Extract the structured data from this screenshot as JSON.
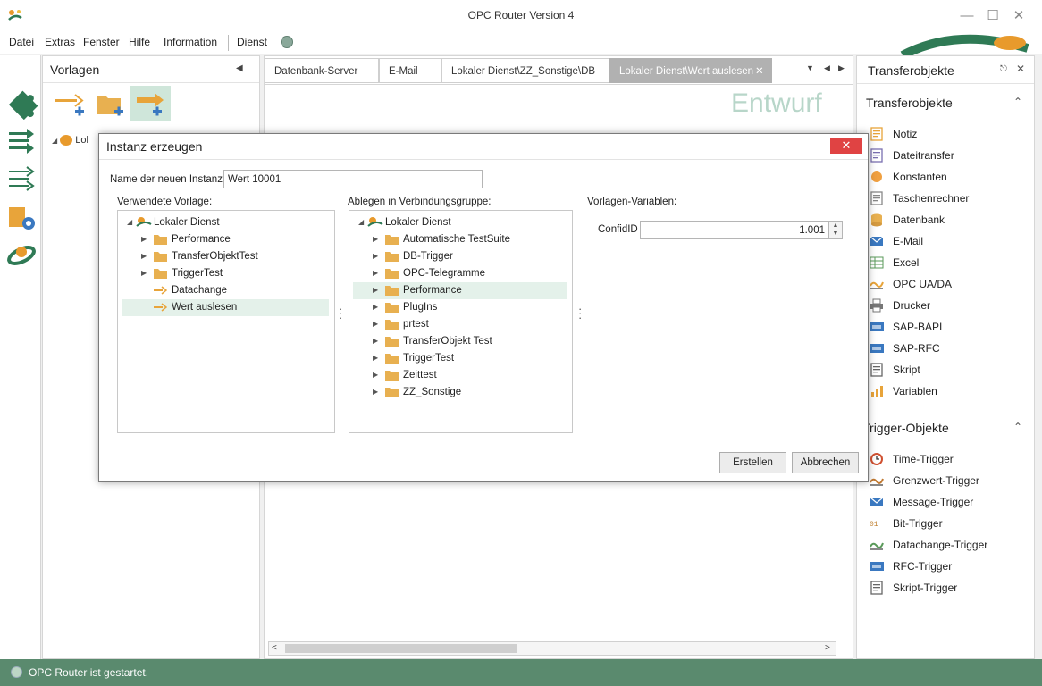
{
  "window": {
    "title": "OPC Router Version 4"
  },
  "menu": {
    "items": [
      "Datei",
      "Extras",
      "Fenster",
      "Hilfe",
      "Information",
      "Dienst"
    ]
  },
  "vorlagen": {
    "title": "Vorlagen",
    "tree_root": "Lokaler Dienst"
  },
  "editor": {
    "tabs": [
      {
        "label": "Datenbank-Server"
      },
      {
        "label": "E-Mail"
      },
      {
        "label": "Lokaler Dienst\\ZZ_Sonstige\\DB"
      },
      {
        "label": "Lokaler Dienst\\Wert auslesen"
      }
    ],
    "watermark": "Entwurf"
  },
  "transfer": {
    "title": "Transferobjekte",
    "section1": "Transferobjekte",
    "items1": [
      {
        "label": "Notiz",
        "icon": "note-icon"
      },
      {
        "label": "Dateitransfer",
        "icon": "file-transfer-icon"
      },
      {
        "label": "Konstanten",
        "icon": "constant-icon"
      },
      {
        "label": "Taschenrechner",
        "icon": "calculator-icon"
      },
      {
        "label": "Datenbank",
        "icon": "database-icon"
      },
      {
        "label": "E-Mail",
        "icon": "email-icon"
      },
      {
        "label": "Excel",
        "icon": "excel-icon"
      },
      {
        "label": "OPC UA/DA",
        "icon": "opc-icon"
      },
      {
        "label": "Drucker",
        "icon": "printer-icon"
      },
      {
        "label": "SAP-BAPI",
        "icon": "sap-bapi-icon"
      },
      {
        "label": "SAP-RFC",
        "icon": "sap-rfc-icon"
      },
      {
        "label": "Skript",
        "icon": "script-icon"
      },
      {
        "label": "Variablen",
        "icon": "variables-icon"
      }
    ],
    "section2": "Trigger-Objekte",
    "items2": [
      {
        "label": "Time-Trigger",
        "icon": "clock-icon"
      },
      {
        "label": "Grenzwert-Trigger",
        "icon": "threshold-icon"
      },
      {
        "label": "Message-Trigger",
        "icon": "message-icon"
      },
      {
        "label": "Bit-Trigger",
        "icon": "bit-icon"
      },
      {
        "label": "Datachange-Trigger",
        "icon": "datachange-icon"
      },
      {
        "label": "RFC-Trigger",
        "icon": "rfc-icon"
      },
      {
        "label": "Skript-Trigger",
        "icon": "script-trigger-icon"
      }
    ]
  },
  "status": {
    "text": "OPC Router ist gestartet."
  },
  "dialog": {
    "title": "Instanz erzeugen",
    "name_label": "Name der neuen Instanz:",
    "name_value": "Wert 10001",
    "vorlage_label": "Verwendete Vorlage:",
    "vorlage_tree": {
      "root": "Lokaler Dienst",
      "children": [
        {
          "label": "Performance",
          "type": "folder"
        },
        {
          "label": "TransferObjektTest",
          "type": "folder"
        },
        {
          "label": "TriggerTest",
          "type": "folder"
        },
        {
          "label": "Datachange",
          "type": "template"
        },
        {
          "label": "Wert auslesen",
          "type": "template",
          "selected": true
        }
      ]
    },
    "gruppe_label": "Ablegen in Verbindungsgruppe:",
    "gruppe_tree": {
      "root": "Lokaler Dienst",
      "children": [
        {
          "label": "Automatische TestSuite"
        },
        {
          "label": "DB-Trigger"
        },
        {
          "label": "OPC-Telegramme"
        },
        {
          "label": "Performance",
          "selected": true
        },
        {
          "label": "PlugIns"
        },
        {
          "label": "prtest"
        },
        {
          "label": "TransferObjekt Test"
        },
        {
          "label": "TriggerTest"
        },
        {
          "label": "Zeittest"
        },
        {
          "label": "ZZ_Sonstige"
        }
      ]
    },
    "variables_label": "Vorlagen-Variablen:",
    "confid_label": "ConfidID",
    "confid_value": "1.001",
    "create_button": "Erstellen",
    "cancel_button": "Abbrechen"
  }
}
